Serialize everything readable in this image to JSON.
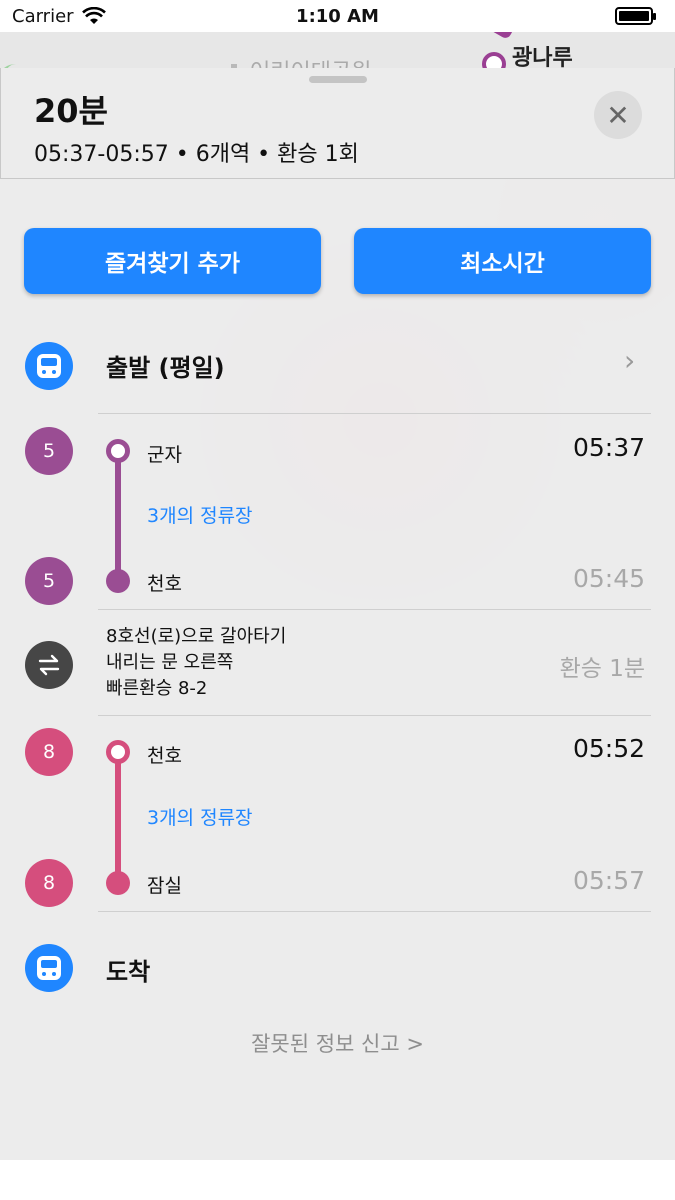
{
  "status_bar": {
    "carrier": "Carrier",
    "time": "1:10 AM"
  },
  "map": {
    "station_label": "광나루",
    "faded_label": "어린이대공원"
  },
  "header": {
    "duration": "20분",
    "summary": "05:37-05:57 • 6개역 • 환승 1회"
  },
  "actions": {
    "favorite_label": "즐겨찾기 추가",
    "min_time_label": "최소시간"
  },
  "depart": {
    "label": "출발 (평일)"
  },
  "segments": [
    {
      "line": "5",
      "color": "#9a4d93",
      "from": "군자",
      "from_time": "05:37",
      "stops_text": "3개의 정류장",
      "to": "천호",
      "to_time": "05:45"
    },
    {
      "line": "8",
      "color": "#d54e7d",
      "from": "천호",
      "from_time": "05:52",
      "stops_text": "3개의 정류장",
      "to": "잠실",
      "to_time": "05:57"
    }
  ],
  "transfer": {
    "icon": "swap-arrows-icon",
    "lines": [
      "8호선(로)으로 갈아타기",
      "내리는 문 오른쪽",
      "빠른환승 8-2"
    ],
    "time": "환승 1분"
  },
  "arrive": {
    "label": "도착"
  },
  "report": {
    "label": "잘못된 정보 신고 >"
  },
  "colors": {
    "accent": "#1f86ff",
    "line5": "#9a4d93",
    "line8": "#d54e7d"
  }
}
